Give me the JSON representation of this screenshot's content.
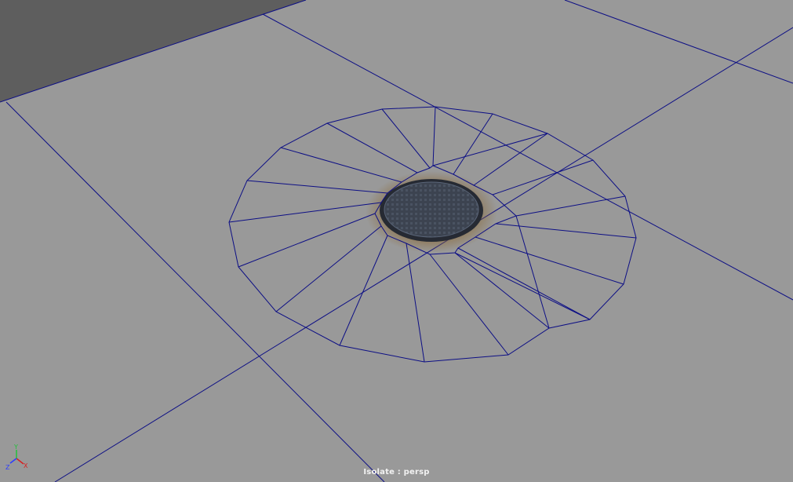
{
  "viewport": {
    "camera_label": "Isolate : persp"
  },
  "axis_gizmo": {
    "x_label": "X",
    "y_label": "Y",
    "z_label": "Z"
  },
  "colors": {
    "background": "#999999",
    "backdrop_plane": "#5e5e5e",
    "wireframe": "#0d0f85",
    "manhole_cover": "#3c4350",
    "dirt_stain": "#8a6a3a",
    "axis_x": "#d62020",
    "axis_y": "#23c13b",
    "axis_z": "#2b3cff",
    "label_text": "#f2f2f2"
  }
}
